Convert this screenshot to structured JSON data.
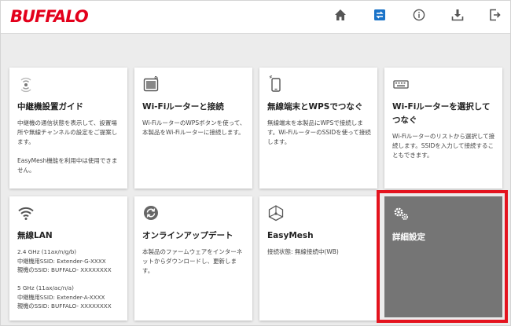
{
  "brand": {
    "logo": "BUFFALO",
    "logo_color": "#e3001b"
  },
  "nav": {
    "icons": [
      "home-icon",
      "network-transfer-icon",
      "info-icon",
      "download-icon",
      "logout-icon"
    ],
    "active_color": "#1a73c8",
    "color": "#555555"
  },
  "cards": {
    "guide": {
      "title": "中継機設置ガイド",
      "desc": "中継機の通信状態を表示して、設置場所や無線チャンネルの設定をご提案します。\n\nEasyMesh機能を利用中は使用できません。"
    },
    "wps": {
      "title": "Wi-Fiルーターと接続",
      "desc": "Wi-FiルーターのWPSボタンを使って、本製品をWi-Fiルーターに接続します。"
    },
    "wireless_wps": {
      "title": "無線端末とWPSでつなぐ",
      "desc": "無線端末を本製品にWPSで接続します。Wi-FiルーターのSSIDを使って接続します。"
    },
    "select_router": {
      "title": "Wi-Fiルーターを選択してつなぐ",
      "desc": "Wi-Fiルーターのリストから選択して接続します。SSIDを入力して接続することもできます。"
    },
    "wlan": {
      "title": "無線LAN",
      "desc": "2.4 GHz (11ax/n/g/b)\n中継機用SSID: Extender-G-XXXX\n親機のSSID: BUFFALO- XXXXXXXX\n\n5 GHz (11ax/ac/n/a)\n中継機用SSID: Extender-A-XXXX\n親機のSSID: BUFFALO- XXXXXXXX"
    },
    "update": {
      "title": "オンラインアップデート",
      "desc": "本製品のファームウェアをインターネットからダウンロードし、更新します。"
    },
    "easymesh": {
      "title": "EasyMesh",
      "desc": "接続状態: 無線接続中(WB)"
    },
    "advanced": {
      "title": "詳細設定"
    }
  },
  "highlight_color": "#e4131e"
}
